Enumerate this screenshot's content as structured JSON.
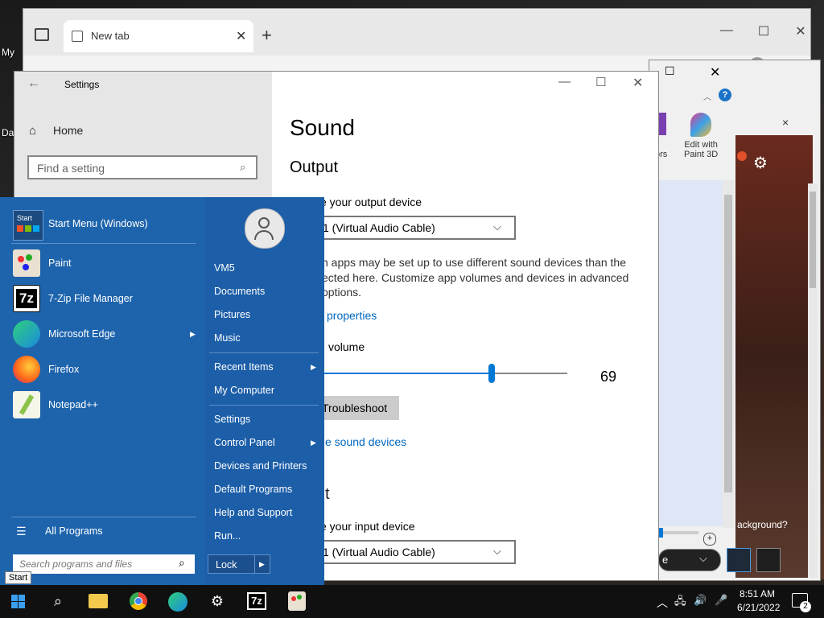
{
  "desktop": {
    "labels": [
      "My",
      "Da"
    ]
  },
  "browser": {
    "tab_title": "New tab",
    "new_tab_symbol": "+",
    "more_symbol": "⋯"
  },
  "paint": {
    "edit3d_line1": "Edit with",
    "edit3d_line2": "Paint 3D",
    "partial_line1": "t",
    "partial_line2": "ors",
    "bg_question": "ackground?",
    "help_symbol": "?",
    "close_symbol": "×"
  },
  "settings": {
    "window_title": "Settings",
    "home": "Home",
    "search_placeholder": "Find a setting",
    "page_title": "Sound",
    "output_heading": "Output",
    "choose_output_label": "e your output device",
    "output_device": "1 (Virtual Audio Cable)",
    "info_line1": "n apps may be set up to use different sound devices than the",
    "info_line2": "ected here. Customize app volumes and devices in advanced",
    "info_line3": "options.",
    "device_properties": "properties",
    "master_volume_label": "volume",
    "volume_value": "69",
    "volume_fraction": 0.69,
    "troubleshoot": "Troubleshoot",
    "manage_devices": "e sound devices",
    "input_heading_partial": "t",
    "choose_input_label": "e your input device",
    "input_device": "1 (Virtual Audio Cable)"
  },
  "start_menu": {
    "pinned_title": "Start Menu (Windows)",
    "pinned_icon_text": "Start",
    "apps": [
      {
        "label": "Paint",
        "has_arrow": false
      },
      {
        "label": "7-Zip File Manager",
        "has_arrow": false
      },
      {
        "label": "Microsoft Edge",
        "has_arrow": true
      },
      {
        "label": "Firefox",
        "has_arrow": false
      },
      {
        "label": "Notepad++",
        "has_arrow": false
      }
    ],
    "all_programs": "All Programs",
    "search_placeholder": "Search programs and files",
    "lock": "Lock",
    "right_items": {
      "user": "VM5",
      "documents": "Documents",
      "pictures": "Pictures",
      "music": "Music",
      "recent_items": "Recent Items",
      "my_computer": "My Computer",
      "settings": "Settings",
      "control_panel": "Control Panel",
      "devices_printers": "Devices and Printers",
      "default_programs": "Default Programs",
      "help_support": "Help and Support",
      "run": "Run..."
    }
  },
  "tooltip": "Start",
  "taskbar": {
    "time": "8:51 AM",
    "date": "6/21/2022",
    "notification_count": "2",
    "zip_label": "7z"
  },
  "colors": {
    "accent": "#0078d4",
    "start_menu": "#1e64ad",
    "taskbar": "#101010"
  }
}
